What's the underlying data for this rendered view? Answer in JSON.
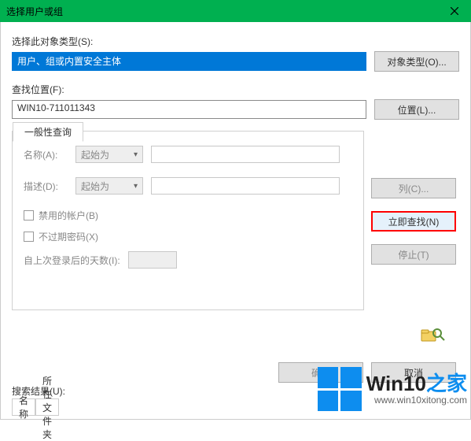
{
  "title": "选择用户或组",
  "sections": {
    "object_type_label": "选择此对象类型(S):",
    "object_type_value": "用户、组或内置安全主体",
    "object_type_button": "对象类型(O)...",
    "location_label": "查找位置(F):",
    "location_value": "WIN10-711011343",
    "location_button": "位置(L)..."
  },
  "query_tab": "一般性查询",
  "query": {
    "name_label": "名称(A):",
    "name_mode": "起始为",
    "desc_label": "描述(D):",
    "desc_mode": "起始为",
    "disabled_accounts": "禁用的帐户(B)",
    "no_expire": "不过期密码(X)",
    "days_label": "自上次登录后的天数(I):"
  },
  "side": {
    "columns": "列(C)...",
    "find_now": "立即查找(N)",
    "stop": "停止(T)"
  },
  "bottom": {
    "ok": "确定",
    "cancel": "取消"
  },
  "results": {
    "label": "搜索结果(U):",
    "col_name": "名称",
    "col_folder": "所在文件夹"
  },
  "watermark": {
    "text_main": "Win10",
    "text_suffix": "之家",
    "url": "www.win10xitong.com"
  }
}
